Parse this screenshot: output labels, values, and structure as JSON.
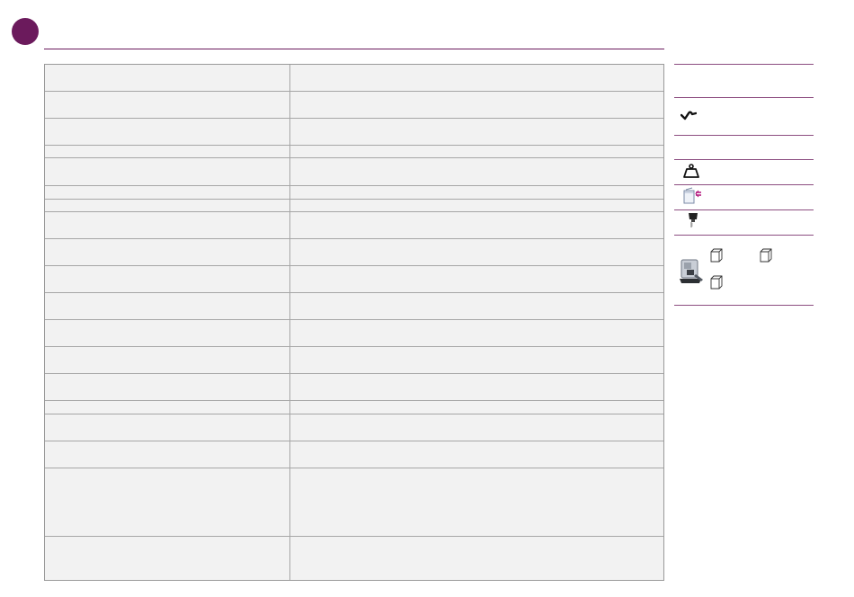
{
  "colors": {
    "accent": "#6b1a5c",
    "row_fill": "#f2f2f2",
    "rule": "#8c4d80"
  },
  "table": {
    "rows": [
      {
        "label": "",
        "value": ""
      },
      {
        "label": "",
        "value": ""
      },
      {
        "label": "",
        "value": ""
      },
      {
        "label": "",
        "value": ""
      },
      {
        "label": "",
        "value": ""
      },
      {
        "label": "",
        "value": ""
      },
      {
        "label": "",
        "value": ""
      },
      {
        "label": "",
        "value": ""
      },
      {
        "label": "",
        "value": ""
      },
      {
        "label": "",
        "value": ""
      },
      {
        "label": "",
        "value": ""
      },
      {
        "label": "",
        "value": ""
      },
      {
        "label": "",
        "value": ""
      },
      {
        "label": "",
        "value": ""
      },
      {
        "label": "",
        "value": ""
      },
      {
        "label": "",
        "value": ""
      },
      {
        "label": "",
        "value": ""
      },
      {
        "label": "",
        "value": ""
      },
      {
        "label": "",
        "value": ""
      }
    ]
  },
  "sidebar": {
    "icons": [
      "check-swoosh-icon",
      "weight-icon",
      "water-tank-icon",
      "coffee-spout-icon",
      "coffee-machine-icon",
      "box-icon"
    ]
  }
}
